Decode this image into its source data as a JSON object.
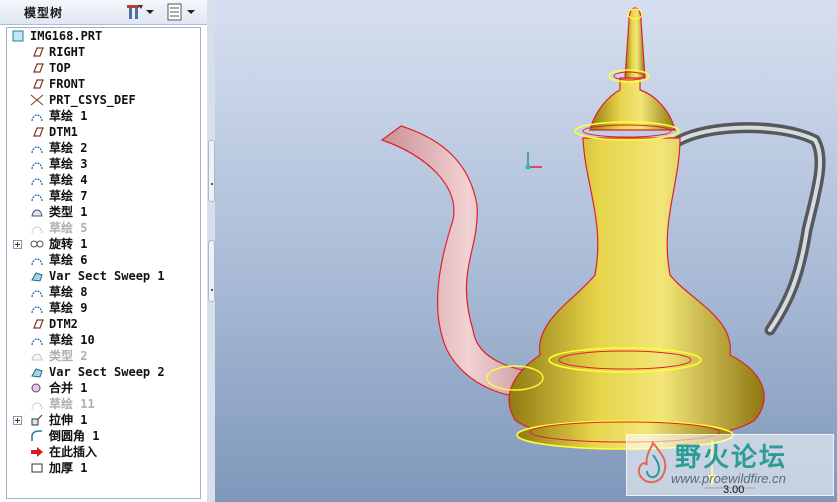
{
  "model_tree": {
    "title": "模型树",
    "items": [
      {
        "label": "IMG168.PRT",
        "icon": "part-icon",
        "dim": false,
        "expandable": false,
        "indent": 0
      },
      {
        "label": "RIGHT",
        "icon": "datum-plane-icon",
        "dim": false,
        "expandable": false,
        "indent": 1
      },
      {
        "label": "TOP",
        "icon": "datum-plane-icon",
        "dim": false,
        "expandable": false,
        "indent": 1
      },
      {
        "label": "FRONT",
        "icon": "datum-plane-icon",
        "dim": false,
        "expandable": false,
        "indent": 1
      },
      {
        "label": "PRT_CSYS_DEF",
        "icon": "csys-icon",
        "dim": false,
        "expandable": false,
        "indent": 1
      },
      {
        "label": "草绘 1",
        "icon": "sketch-icon",
        "dim": false,
        "expandable": false,
        "indent": 1
      },
      {
        "label": "DTM1",
        "icon": "datum-plane-icon",
        "dim": false,
        "expandable": false,
        "indent": 1
      },
      {
        "label": "草绘 2",
        "icon": "sketch-icon",
        "dim": false,
        "expandable": false,
        "indent": 1
      },
      {
        "label": "草绘 3",
        "icon": "sketch-icon",
        "dim": false,
        "expandable": false,
        "indent": 1
      },
      {
        "label": "草绘 4",
        "icon": "sketch-icon",
        "dim": false,
        "expandable": false,
        "indent": 1
      },
      {
        "label": "草绘 7",
        "icon": "sketch-icon",
        "dim": false,
        "expandable": false,
        "indent": 1
      },
      {
        "label": "类型 1",
        "icon": "type-icon",
        "dim": false,
        "expandable": false,
        "indent": 1
      },
      {
        "label": "草绘 5",
        "icon": "sketch-icon",
        "dim": true,
        "expandable": false,
        "indent": 1
      },
      {
        "label": "旋转 1",
        "icon": "revolve-icon",
        "dim": false,
        "expandable": true,
        "indent": 1
      },
      {
        "label": "草绘 6",
        "icon": "sketch-icon",
        "dim": false,
        "expandable": false,
        "indent": 1
      },
      {
        "label": "Var Sect Sweep 1",
        "icon": "sweep-icon",
        "dim": false,
        "expandable": false,
        "indent": 1
      },
      {
        "label": "草绘 8",
        "icon": "sketch-icon",
        "dim": false,
        "expandable": false,
        "indent": 1
      },
      {
        "label": "草绘 9",
        "icon": "sketch-icon",
        "dim": false,
        "expandable": false,
        "indent": 1
      },
      {
        "label": "DTM2",
        "icon": "datum-plane-icon",
        "dim": false,
        "expandable": false,
        "indent": 1
      },
      {
        "label": "草绘 10",
        "icon": "sketch-icon",
        "dim": false,
        "expandable": false,
        "indent": 1
      },
      {
        "label": "类型 2",
        "icon": "type-icon",
        "dim": true,
        "expandable": false,
        "indent": 1
      },
      {
        "label": "Var Sect Sweep 2",
        "icon": "sweep-icon",
        "dim": false,
        "expandable": false,
        "indent": 1
      },
      {
        "label": "合并 1",
        "icon": "merge-icon",
        "dim": false,
        "expandable": false,
        "indent": 1
      },
      {
        "label": "草绘 11",
        "icon": "sketch-icon",
        "dim": true,
        "expandable": false,
        "indent": 1
      },
      {
        "label": "拉伸 1",
        "icon": "extrude-icon",
        "dim": false,
        "expandable": true,
        "indent": 1
      },
      {
        "label": "倒圆角 1",
        "icon": "round-icon",
        "dim": false,
        "expandable": false,
        "indent": 1
      },
      {
        "label": "在此插入",
        "icon": "insert-here-arrow-icon",
        "dim": false,
        "expandable": false,
        "indent": 1
      },
      {
        "label": "加厚 1",
        "icon": "thicken-icon",
        "dim": false,
        "expandable": false,
        "indent": 1
      }
    ]
  },
  "viewport": {
    "scale_label": "3.00",
    "watermark_title": "野火论坛",
    "watermark_url": "www.proewildfire.cn"
  },
  "colors": {
    "body_gold": "#c9b227",
    "spout_pink": "#e2b2b6",
    "handle_grey": "#6e7276",
    "edge_red": "#e0202a",
    "edge_yellow": "#ffff33"
  }
}
